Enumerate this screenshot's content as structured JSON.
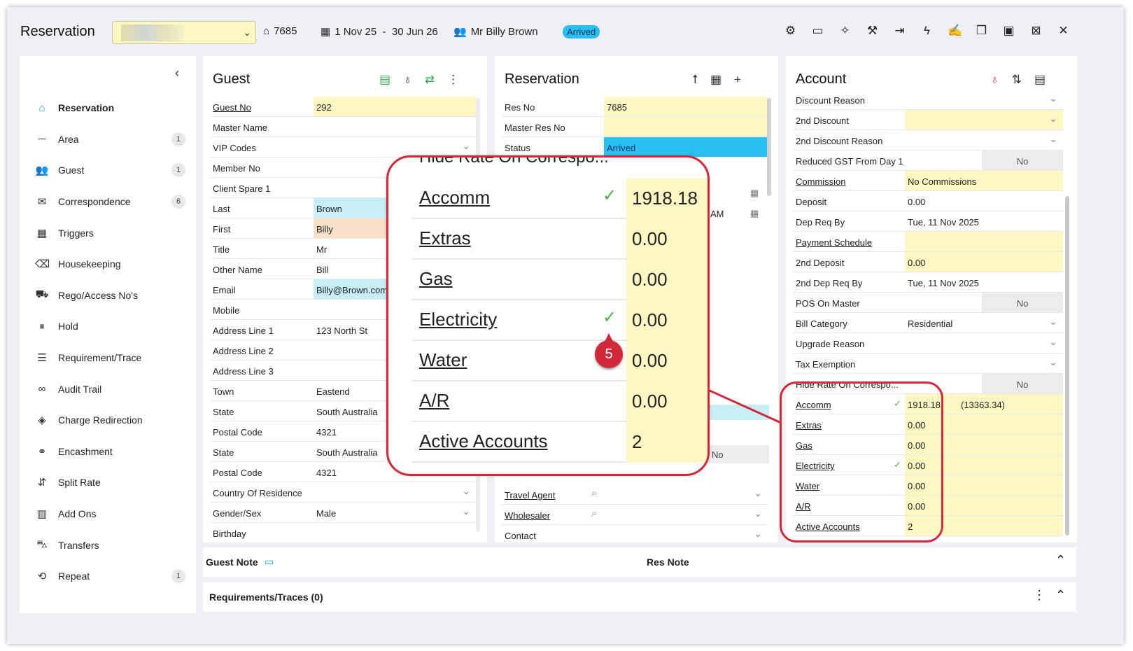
{
  "header": {
    "title": "Reservation",
    "res_no": "7685",
    "dates": "1 Nov 25  -  30 Jun 26",
    "guest": "Mr Billy Brown",
    "status": "Arrived"
  },
  "sidebar": {
    "items": [
      {
        "label": "Reservation",
        "icon": "home-icon",
        "count": ""
      },
      {
        "label": "Area",
        "icon": "bed-icon",
        "count": "1"
      },
      {
        "label": "Guest",
        "icon": "users-icon",
        "count": "1"
      },
      {
        "label": "Correspondence",
        "icon": "envelope-icon",
        "count": "6"
      },
      {
        "label": "Triggers",
        "icon": "calendar-icon",
        "count": ""
      },
      {
        "label": "Housekeeping",
        "icon": "broom-icon",
        "count": ""
      },
      {
        "label": "Rego/Access No's",
        "icon": "car-icon",
        "count": ""
      },
      {
        "label": "Hold",
        "icon": "pause-icon",
        "count": ""
      },
      {
        "label": "Requirement/Trace",
        "icon": "list-icon",
        "count": ""
      },
      {
        "label": "Audit Trail",
        "icon": "glasses-icon",
        "count": ""
      },
      {
        "label": "Charge Redirection",
        "icon": "diamond-icon",
        "count": ""
      },
      {
        "label": "Encashment",
        "icon": "hand-coin-icon",
        "count": ""
      },
      {
        "label": "Split Rate",
        "icon": "split-icon",
        "count": ""
      },
      {
        "label": "Add Ons",
        "icon": "grid-icon",
        "count": ""
      },
      {
        "label": "Transfers",
        "icon": "bus-icon",
        "count": ""
      },
      {
        "label": "Repeat",
        "icon": "repeat-icon",
        "count": "1"
      }
    ]
  },
  "guest_panel": {
    "title": "Guest",
    "rows": [
      {
        "label": "Guest No",
        "value": "292",
        "style": "yellow",
        "link": true
      },
      {
        "label": "Master Name",
        "value": "",
        "style": "",
        "link": false
      },
      {
        "label": "VIP Codes",
        "value": "",
        "style": "",
        "link": false,
        "dropdown": true
      },
      {
        "label": "Member No",
        "value": "",
        "style": "",
        "link": false
      },
      {
        "label": "Client Spare 1",
        "value": "",
        "style": "",
        "link": false
      },
      {
        "label": "Last",
        "value": "Brown",
        "style": "cyan",
        "link": false
      },
      {
        "label": "First",
        "value": "Billy",
        "style": "peach",
        "link": false
      },
      {
        "label": "Title",
        "value": "Mr",
        "style": "",
        "link": false
      },
      {
        "label": "Other Name",
        "value": "Bill",
        "style": "",
        "link": false
      },
      {
        "label": "Email",
        "value": "Billy@Brown.com",
        "style": "cyan",
        "link": false
      },
      {
        "label": "Mobile",
        "value": "",
        "style": "",
        "link": false,
        "dropdown": true
      },
      {
        "label": "Address Line 1",
        "value": "123 North St",
        "style": "",
        "link": false
      },
      {
        "label": "Address Line 2",
        "value": "",
        "style": "",
        "link": false
      },
      {
        "label": "Address Line 3",
        "value": "",
        "style": "",
        "link": false
      },
      {
        "label": "Town",
        "value": "Eastend",
        "style": "",
        "link": false
      },
      {
        "label": "State",
        "value": "South Australia",
        "style": "",
        "link": false
      },
      {
        "label": "Postal Code",
        "value": "4321",
        "style": "",
        "link": false
      },
      {
        "label": "State",
        "value": "South Australia",
        "style": "",
        "link": false
      },
      {
        "label": "Postal Code",
        "value": "4321",
        "style": "",
        "link": false
      },
      {
        "label": "Country Of Residence",
        "value": "",
        "style": "",
        "link": false,
        "dropdown": true
      },
      {
        "label": "Gender/Sex",
        "value": "Male",
        "style": "",
        "link": false,
        "dropdown": true
      },
      {
        "label": "Birthday",
        "value": "",
        "style": "",
        "link": false
      }
    ]
  },
  "res_panel": {
    "title": "Reservation",
    "rows": [
      {
        "label": "Res No",
        "value": "7685",
        "style": "yellow",
        "link": false
      },
      {
        "label": "Master Res No",
        "value": "",
        "style": "yellow",
        "link": false
      },
      {
        "label": "Status",
        "value": "Arrived",
        "style": "blue",
        "link": false
      }
    ],
    "lower_rows": [
      {
        "label": "Travel Agent",
        "link": true
      },
      {
        "label": "Wholesaler",
        "link": true
      },
      {
        "label": "Contact",
        "link": false
      }
    ],
    "no_value": "No",
    "am_text": "AM"
  },
  "account_panel": {
    "title": "Account",
    "rows": [
      {
        "label": "Discount Reason",
        "value": "",
        "style": "",
        "link": false,
        "dropdown": true
      },
      {
        "label": "2nd Discount",
        "value": "",
        "style": "yellow",
        "link": false,
        "dropdown": true
      },
      {
        "label": "2nd Discount Reason",
        "value": "",
        "style": "",
        "link": false,
        "dropdown": true
      },
      {
        "label": "Reduced GST From Day 1",
        "value": "No",
        "style": "grey",
        "link": false
      },
      {
        "label": "Commission",
        "value": "No Commissions",
        "style": "yellow",
        "link": true
      },
      {
        "label": "Deposit",
        "value": "0.00",
        "style": "",
        "link": false
      },
      {
        "label": "Dep Req By",
        "value": "Tue, 11 Nov 2025",
        "style": "",
        "link": false
      },
      {
        "label": "Payment Schedule",
        "value": "",
        "style": "yellow",
        "link": true
      },
      {
        "label": "2nd Deposit",
        "value": "0.00",
        "style": "yellow",
        "link": false
      },
      {
        "label": "2nd Dep Req By",
        "value": "Tue, 11 Nov 2025",
        "style": "",
        "link": false
      },
      {
        "label": "POS On Master",
        "value": "No",
        "style": "grey",
        "link": false
      },
      {
        "label": "Bill Category",
        "value": "Residential",
        "style": "",
        "link": false,
        "dropdown": true
      },
      {
        "label": "Upgrade Reason",
        "value": "",
        "style": "",
        "link": false,
        "dropdown": true
      },
      {
        "label": "Tax Exemption",
        "value": "",
        "style": "",
        "link": false,
        "dropdown": true
      },
      {
        "label": "Hide Rate On Correspo...",
        "value": "No",
        "style": "grey",
        "link": false
      },
      {
        "label": "Accomm",
        "value": "1918.18",
        "extra": "(13363.34)",
        "style": "yellow",
        "link": true,
        "check": true
      },
      {
        "label": "Extras",
        "value": "0.00",
        "style": "yellow",
        "link": true
      },
      {
        "label": "Gas",
        "value": "0.00",
        "style": "yellow",
        "link": true
      },
      {
        "label": "Electricity",
        "value": "0.00",
        "style": "yellow",
        "link": true,
        "check": true
      },
      {
        "label": "Water",
        "value": "0.00",
        "style": "yellow",
        "link": true
      },
      {
        "label": "A/R",
        "value": "0.00",
        "style": "yellow",
        "link": true
      },
      {
        "label": "Active Accounts",
        "value": "2",
        "style": "yellow",
        "link": true
      }
    ]
  },
  "zoom": {
    "header": "Hide Rate On Correspo...",
    "rows": [
      {
        "label": "Accomm",
        "value": "1918.18",
        "check": true
      },
      {
        "label": "Extras",
        "value": "0.00",
        "check": false
      },
      {
        "label": "Gas",
        "value": "0.00",
        "check": false
      },
      {
        "label": "Electricity",
        "value": "0.00",
        "check": true
      },
      {
        "label": "Water",
        "value": "0.00",
        "check": false
      },
      {
        "label": "A/R",
        "value": "0.00",
        "check": false
      },
      {
        "label": "Active Accounts",
        "value": "2",
        "check": false
      }
    ],
    "marker": "5"
  },
  "bottom": {
    "guest_note": "Guest Note",
    "res_note": "Res Note",
    "requirements": "Requirements/Traces (0)"
  },
  "colors": {
    "highlight": "#d0293a",
    "yellow_field": "#fdf7c4",
    "status_blue": "#29c0f1",
    "accent": "#1ea6c9"
  }
}
